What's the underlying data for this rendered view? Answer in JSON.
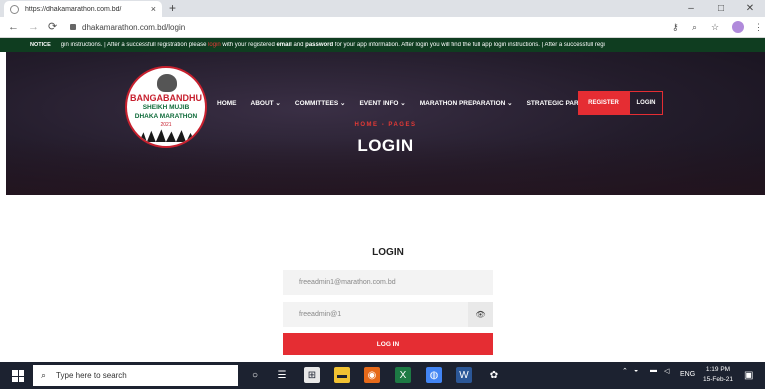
{
  "browser": {
    "tab_title": "https://dhakamarathon.com.bd/",
    "tab_close": "×",
    "new_tab": "+",
    "url": "dhakamarathon.com.bd/login",
    "back": "←",
    "forward": "→",
    "reload": "⟳",
    "win_min": "–",
    "win_max": "□",
    "win_close": "✕"
  },
  "notice": {
    "label": "NOTICE",
    "pre": "gin instructions.  |    After a successfull registration please ",
    "highlight": "login",
    "mid1": " with your registered ",
    "bold1": "email",
    "mid2": " and ",
    "bold2": "password",
    "post": " for your app information. After login you will find the full app login instructions.  |     After a successfull regi"
  },
  "logo": {
    "line1": "BANGABANDHU",
    "line2": "SHEIKH MUJIB",
    "line3": "DHAKA MARATHON",
    "line4": "2021"
  },
  "nav": {
    "items": [
      {
        "label": "HOME"
      },
      {
        "label": "ABOUT ⌄"
      },
      {
        "label": "COMMITTEES ⌄"
      },
      {
        "label": "EVENT INFO ⌄"
      },
      {
        "label": "MARATHON PREPARATION ⌄"
      },
      {
        "label": "STRATEGIC PARTNERS ⌄"
      }
    ],
    "register": "REGISTER",
    "login": "LOGIN"
  },
  "hero": {
    "crumb_home": "HOME",
    "crumb_sep": " - ",
    "crumb_page": "PAGES",
    "title": "LOGIN"
  },
  "form": {
    "title": "LOGIN",
    "email_value": "freeadmin1@marathon.com.bd",
    "password_value": "freeadmin@1",
    "eye": "👁",
    "submit": "LOG IN"
  },
  "taskbar": {
    "search_placeholder": "Type here to search",
    "tray_lang": "ENG",
    "time": "1:19 PM",
    "date": "15-Feb-21"
  }
}
